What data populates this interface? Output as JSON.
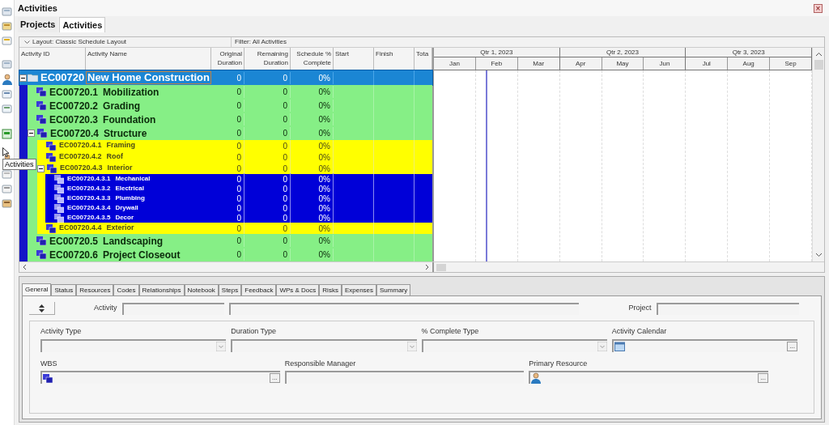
{
  "window": {
    "title": "Activities",
    "close_glyph": "×"
  },
  "tabs": [
    {
      "label": "Projects",
      "selected": false
    },
    {
      "label": "Activities",
      "selected": true
    }
  ],
  "tooltip": "Activities",
  "layout_bar": {
    "layout": "Layout: Classic Schedule Layout",
    "filter": "Filter: All Activities"
  },
  "table": {
    "columns": [
      {
        "label": "Activity ID"
      },
      {
        "label": "Activity Name"
      },
      {
        "label": "Original Duration"
      },
      {
        "label": "Remaining Duration"
      },
      {
        "label": "Schedule % Complete"
      },
      {
        "label": "Start"
      },
      {
        "label": "Finish"
      },
      {
        "label": "Tota"
      }
    ],
    "rows": [
      {
        "id": "EC00720",
        "name": "New Home Construction",
        "original": "0",
        "remaining": "0",
        "complete": "0%",
        "selected": true,
        "expanded": true,
        "children": [
          {
            "id": "EC00720.1",
            "name": "Mobilization",
            "original": "0",
            "remaining": "0",
            "complete": "0%",
            "selected": false
          },
          {
            "id": "EC00720.2",
            "name": "Grading",
            "original": "0",
            "remaining": "0",
            "complete": "0%",
            "selected": false
          },
          {
            "id": "EC00720.3",
            "name": "Foundation",
            "original": "0",
            "remaining": "0",
            "complete": "0%",
            "selected": false
          },
          {
            "id": "EC00720.4",
            "name": "Structure",
            "original": "0",
            "remaining": "0",
            "complete": "0%",
            "selected": false,
            "expanded": true,
            "children": [
              {
                "id": "EC00720.4.1",
                "name": "Framing",
                "original": "0",
                "remaining": "0",
                "complete": "0%",
                "selected": false
              },
              {
                "id": "EC00720.4.2",
                "name": "Roof",
                "original": "0",
                "remaining": "0",
                "complete": "0%",
                "selected": false
              },
              {
                "id": "EC00720.4.3",
                "name": "Interior",
                "original": "0",
                "remaining": "0",
                "complete": "0%",
                "selected": false,
                "expanded": true,
                "children": [
                  {
                    "id": "EC00720.4.3.1",
                    "name": "Mechanical",
                    "original": "0",
                    "remaining": "0",
                    "complete": "0%",
                    "selected": false
                  },
                  {
                    "id": "EC00720.4.3.2",
                    "name": "Electrical",
                    "original": "0",
                    "remaining": "0",
                    "complete": "0%",
                    "selected": false
                  },
                  {
                    "id": "EC00720.4.3.3",
                    "name": "Plumbing",
                    "original": "0",
                    "remaining": "0",
                    "complete": "0%",
                    "selected": false
                  },
                  {
                    "id": "EC00720.4.3.4",
                    "name": "Drywall",
                    "original": "0",
                    "remaining": "0",
                    "complete": "0%",
                    "selected": false
                  },
                  {
                    "id": "EC00720.4.3.5",
                    "name": "Decor",
                    "original": "0",
                    "remaining": "0",
                    "complete": "0%",
                    "selected": false
                  }
                ]
              },
              {
                "id": "EC00720.4.4",
                "name": "Exterior",
                "original": "0",
                "remaining": "0",
                "complete": "0%",
                "selected": false
              }
            ]
          },
          {
            "id": "EC00720.5",
            "name": "Landscaping",
            "original": "0",
            "remaining": "0",
            "complete": "0%",
            "selected": false
          },
          {
            "id": "EC00720.6",
            "name": "Project Closeout",
            "original": "0",
            "remaining": "0",
            "complete": "0%",
            "selected": false
          }
        ]
      }
    ]
  },
  "gantt": {
    "quarters": [
      {
        "label": "Qtr 1, 2023",
        "months": [
          "Jan",
          "Feb",
          "Mar"
        ]
      },
      {
        "label": "Qtr 2, 2023",
        "months": [
          "Apr",
          "May",
          "Jun"
        ]
      },
      {
        "label": "Qtr 3, 2023",
        "months": [
          "Jul",
          "Aug",
          "Sep"
        ]
      }
    ]
  },
  "details": {
    "tabs": [
      {
        "label": "General",
        "selected": true
      },
      {
        "label": "Status",
        "selected": false
      },
      {
        "label": "Resources",
        "selected": false
      },
      {
        "label": "Codes",
        "selected": false
      },
      {
        "label": "Relationships",
        "selected": false
      },
      {
        "label": "Notebook",
        "selected": false
      },
      {
        "label": "Steps",
        "selected": false
      },
      {
        "label": "Feedback",
        "selected": false
      },
      {
        "label": "WPs & Docs",
        "selected": false
      },
      {
        "label": "Risks",
        "selected": false
      },
      {
        "label": "Expenses",
        "selected": false
      },
      {
        "label": "Summary",
        "selected": false
      }
    ],
    "activity_label": "Activity",
    "project_label": "Project",
    "fields_row1": [
      {
        "label": "Activity Type",
        "kind": "dropdown"
      },
      {
        "label": "Duration Type",
        "kind": "dropdown"
      },
      {
        "label": "% Complete Type",
        "kind": "dropdown"
      },
      {
        "label": "Activity Calendar",
        "kind": "calendar",
        "browse": "..."
      }
    ],
    "fields_row2": [
      {
        "label": "WBS",
        "kind": "wbs",
        "browse": "..."
      },
      {
        "label": "Responsible Manager",
        "kind": "text"
      },
      {
        "label": "Primary Resource",
        "kind": "resource",
        "browse": "..."
      }
    ]
  }
}
